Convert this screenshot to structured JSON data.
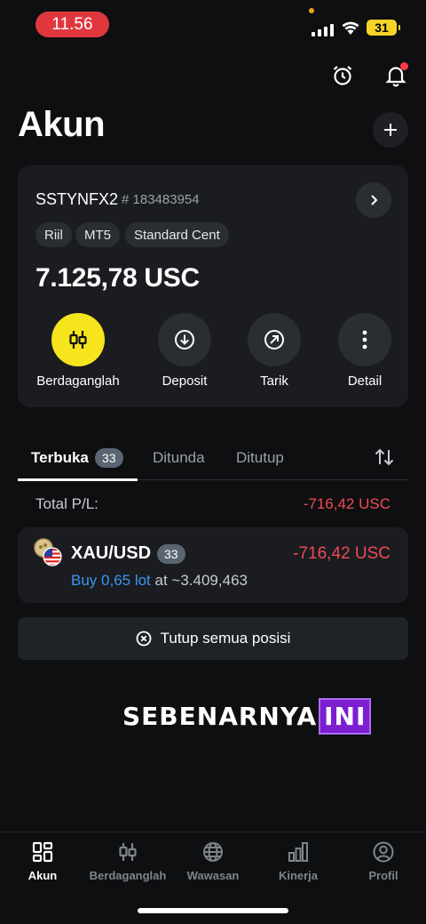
{
  "status_bar": {
    "time": "11.56",
    "battery": "31"
  },
  "header": {
    "title": "Akun"
  },
  "account": {
    "name": "SSTYNFX2",
    "number": "# 183483954",
    "tags": [
      "Riil",
      "MT5",
      "Standard Cent"
    ],
    "balance": "7.125,78 USC",
    "actions": [
      {
        "label": "Berdaganglah",
        "icon": "candlestick-icon"
      },
      {
        "label": "Deposit",
        "icon": "download-icon"
      },
      {
        "label": "Tarik",
        "icon": "withdraw-arrow-icon"
      },
      {
        "label": "Detail",
        "icon": "more-vertical-icon"
      }
    ]
  },
  "tabs": {
    "items": [
      {
        "label": "Terbuka",
        "badge": "33",
        "active": true
      },
      {
        "label": "Ditunda"
      },
      {
        "label": "Ditutup"
      }
    ],
    "sort_icon": "sort-arrows-icon"
  },
  "total_pl": {
    "label": "Total P/L:",
    "value": "-716,42 USC"
  },
  "position": {
    "symbol": "XAU/USD",
    "count": "33",
    "pl": "-716,42 USC",
    "side_lot": "Buy 0,65 lot",
    "price": "at ~3.409,463"
  },
  "close_all": {
    "label": "Tutup semua posisi"
  },
  "watermark": {
    "text1": "SEBENARNYA",
    "text2": "INI"
  },
  "bottom_nav": [
    {
      "label": "Akun",
      "icon": "grid-icon",
      "active": true
    },
    {
      "label": "Berdaganglah",
      "icon": "candlestick-icon"
    },
    {
      "label": "Wawasan",
      "icon": "globe-icon"
    },
    {
      "label": "Kinerja",
      "icon": "bar-chart-icon"
    },
    {
      "label": "Profil",
      "icon": "profile-icon"
    }
  ],
  "colors": {
    "accent": "#f6e51d",
    "negative": "#ef4a55",
    "link": "#3d95f5",
    "background": "#0e0f11"
  }
}
